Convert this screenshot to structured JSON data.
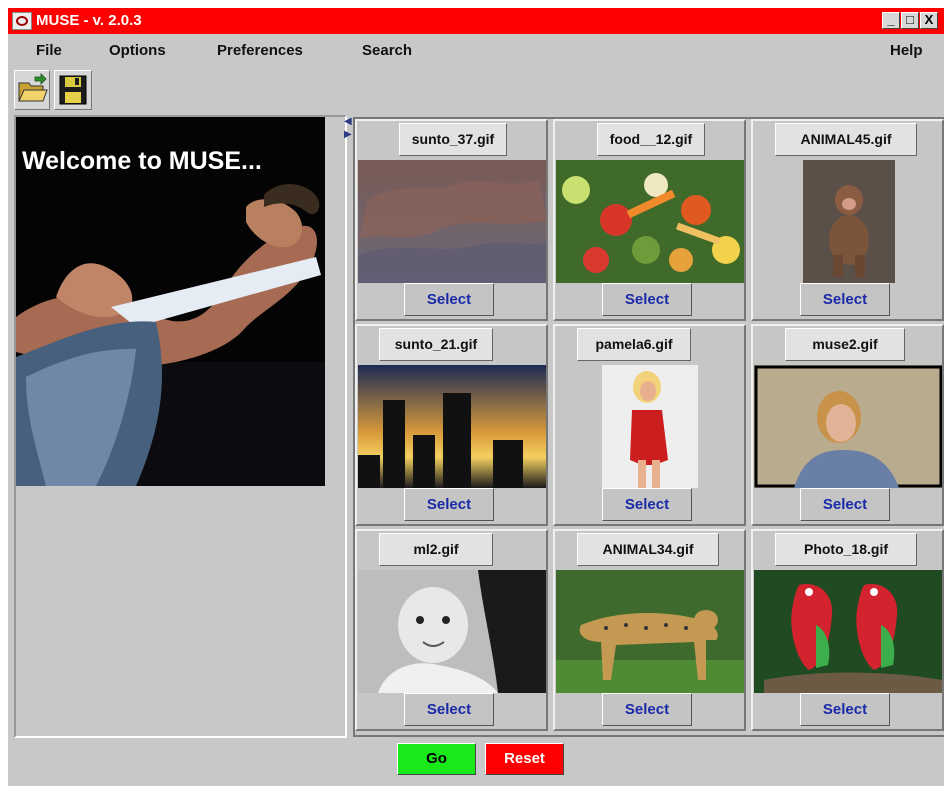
{
  "window": {
    "title": "MUSE - v. 2.0.3",
    "controls": [
      "_",
      "□",
      "X"
    ]
  },
  "menu": [
    "File",
    "Options",
    "Preferences",
    "Search",
    "Help"
  ],
  "toolbar": {
    "open_icon": "open-folder-icon",
    "save_icon": "save-disk-icon"
  },
  "left_panel": {
    "welcome_text": "Welcome to MUSE..."
  },
  "grid": {
    "items": [
      {
        "filename": "sunto_37.gif",
        "select_label": "Select"
      },
      {
        "filename": "food__12.gif",
        "select_label": "Select"
      },
      {
        "filename": "ANIMAL45.gif",
        "select_label": "Select"
      },
      {
        "filename": "sunto_21.gif",
        "select_label": "Select"
      },
      {
        "filename": "pamela6.gif",
        "select_label": "Select"
      },
      {
        "filename": "muse2.gif",
        "select_label": "Select"
      },
      {
        "filename": "ml2.gif",
        "select_label": "Select"
      },
      {
        "filename": "ANIMAL34.gif",
        "select_label": "Select"
      },
      {
        "filename": "Photo_18.gif",
        "select_label": "Select"
      }
    ]
  },
  "actions": {
    "go_label": "Go",
    "reset_label": "Reset"
  },
  "colors": {
    "titlebar": "#ff0000",
    "go_button": "#19e819",
    "reset_button": "#ff0000",
    "select_text": "#1a2aa8"
  }
}
